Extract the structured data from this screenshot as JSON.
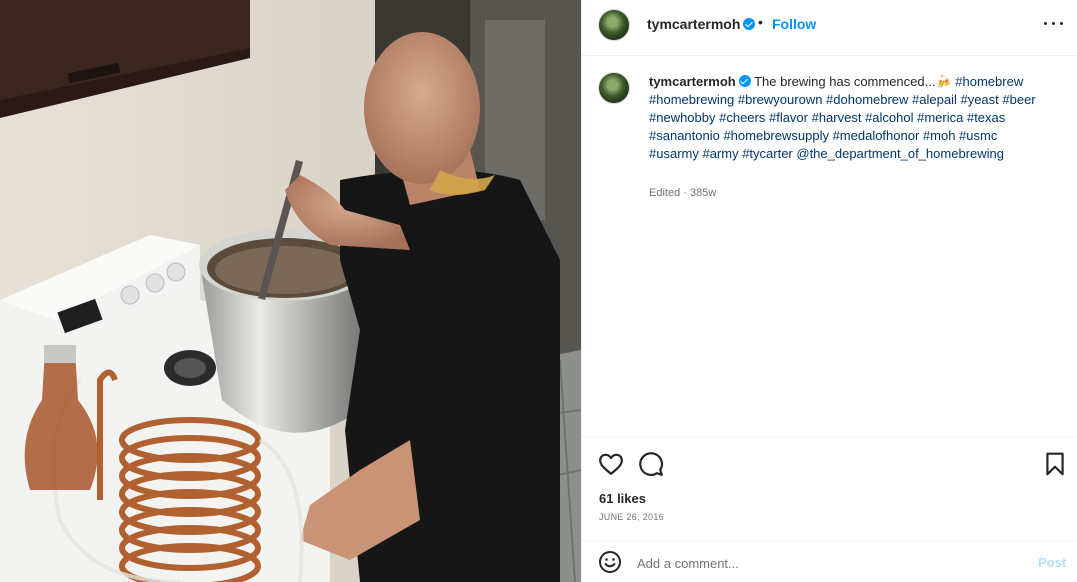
{
  "post": {
    "username": "tymcartermoh",
    "follow_label": "Follow",
    "separator": "•"
  },
  "caption": {
    "username": "tymcartermoh",
    "text": "The brewing has commenced...🍻",
    "hashtags": "#homebrew #homebrewing #brewyourown #dohomebrew #alepail #yeast #beer #newhobby #cheers #flavor #harvest #alcohol #merica #texas #sanantonio #homebrewsupply #medalofhonor #moh #usmc #usarmy #army #tycarter @the_department_of_homebrewing",
    "meta": "Edited · 385w"
  },
  "stats": {
    "likes": "61 likes",
    "date": "JUNE 26, 2016"
  },
  "comment": {
    "placeholder": "Add a comment...",
    "post_label": "Post"
  },
  "icons": {
    "verified": "verified-badge-icon",
    "more": "more-options-icon",
    "like": "heart-icon",
    "comment": "comment-bubble-icon",
    "save": "bookmark-icon",
    "emoji": "emoji-icon"
  },
  "colors": {
    "accent": "#0095f6",
    "link": "#00376b",
    "muted": "#737373",
    "post_disabled": "#b2dffc"
  }
}
